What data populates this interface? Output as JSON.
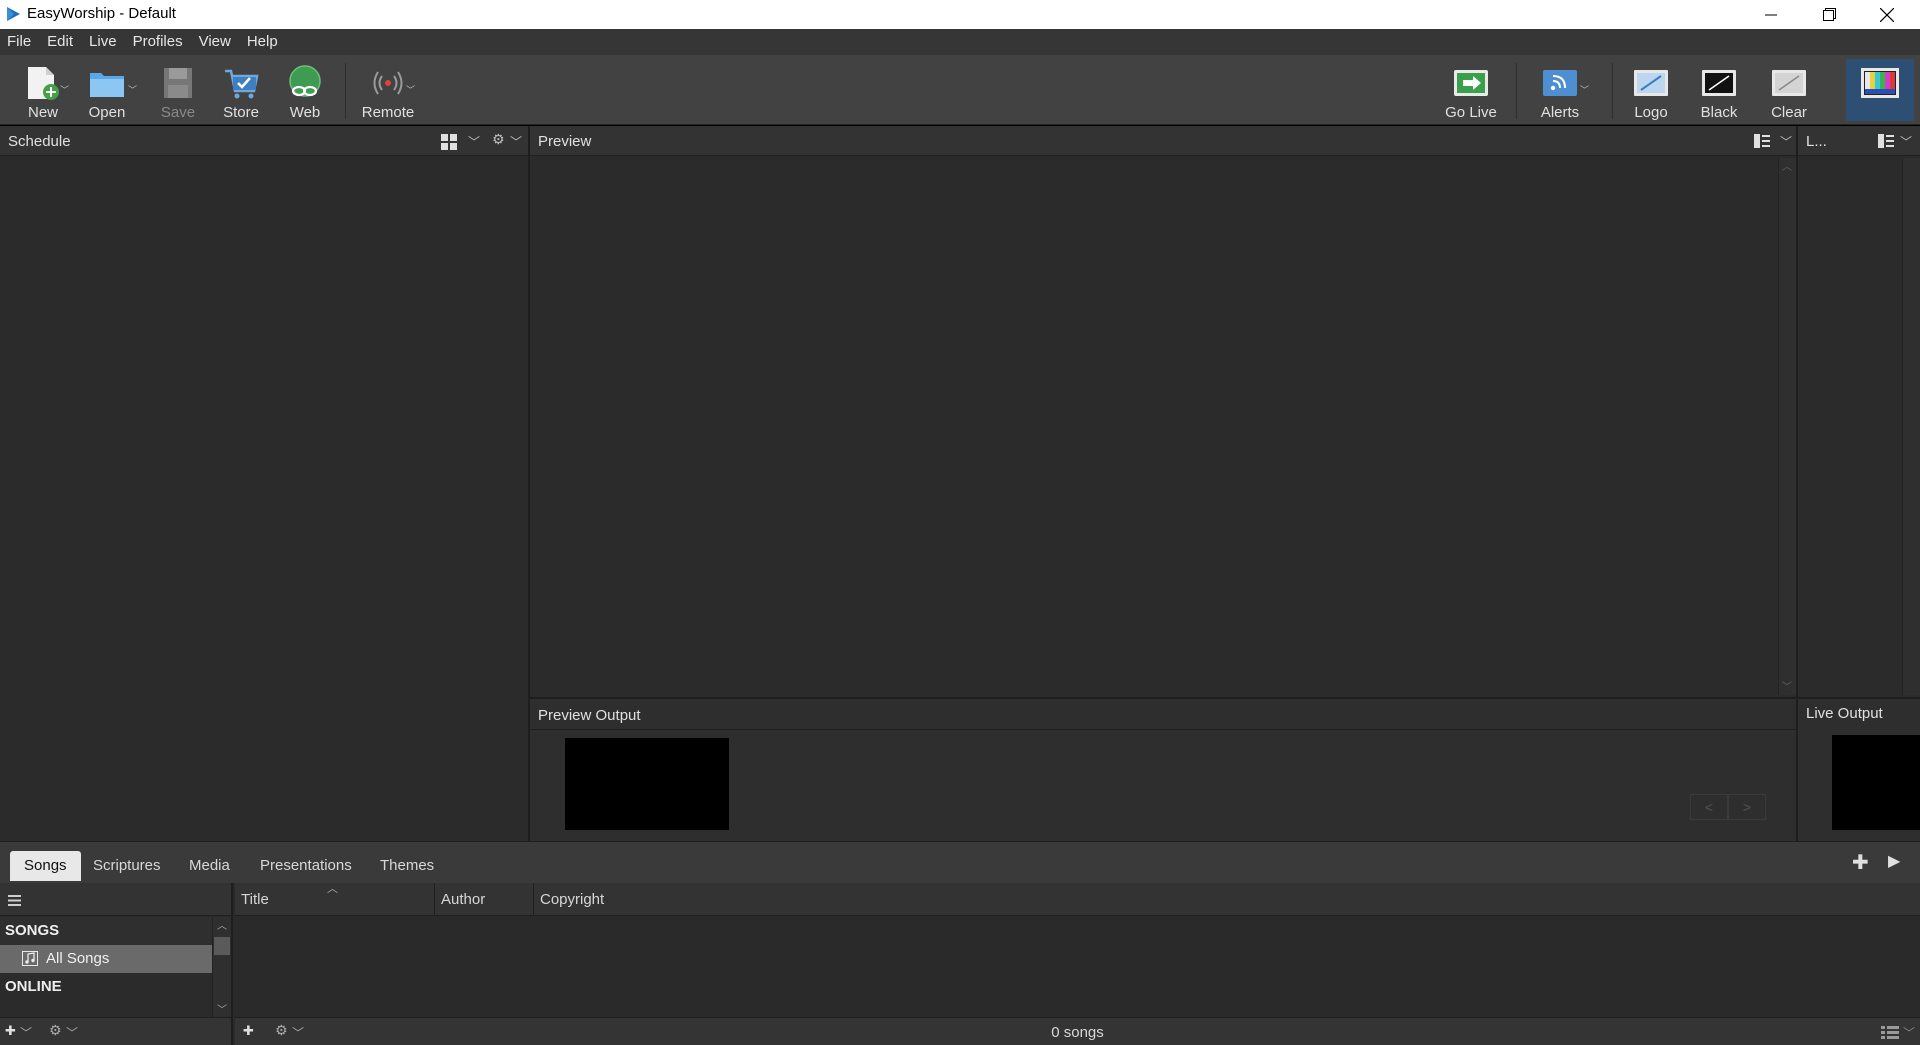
{
  "window": {
    "title": "EasyWorship - Default",
    "app_icon": "easyworship-play-icon",
    "controls": [
      "minimize-icon",
      "restore-icon",
      "close-icon"
    ]
  },
  "menu": {
    "items": [
      "File",
      "Edit",
      "Live",
      "Profiles",
      "View",
      "Help"
    ]
  },
  "toolbar": {
    "new": "New",
    "open": "Open",
    "save": "Save",
    "store": "Store",
    "web": "Web",
    "remote": "Remote",
    "go_live": "Go Live",
    "alerts": "Alerts",
    "logo": "Logo",
    "black": "Black",
    "clear": "Clear"
  },
  "panels": {
    "schedule": "Schedule",
    "preview": "Preview",
    "live_short": "L...",
    "preview_output": "Preview Output",
    "live_output": "Live Output"
  },
  "tabs": {
    "items": [
      "Songs",
      "Scriptures",
      "Media",
      "Presentations",
      "Themes"
    ],
    "active": "Songs"
  },
  "library": {
    "categories": {
      "songs_header": "SONGS",
      "all_songs": "All Songs",
      "online_header": "ONLINE"
    },
    "columns": {
      "title": "Title",
      "author": "Author",
      "copyright": "Copyright"
    },
    "status": "0 songs"
  },
  "colors": {
    "accent": "#1d6fb8",
    "go_live_green": "#3aa04a",
    "panel_bg": "#2b2b2b"
  }
}
